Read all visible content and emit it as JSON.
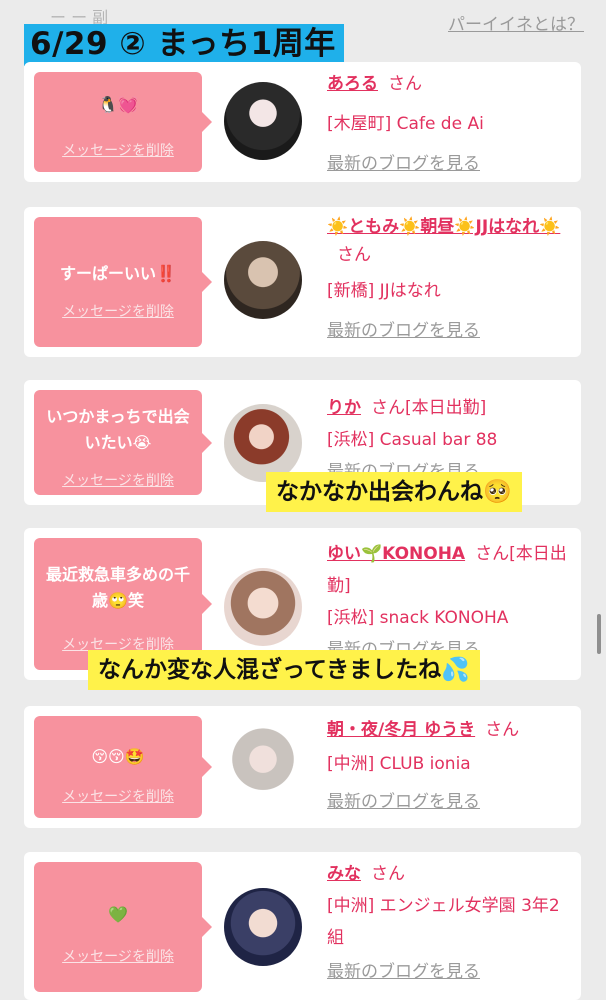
{
  "top": {
    "faded_text": "ー ー 副",
    "link": "パーイイネとは？",
    "banner": "6/29 ② まっち1周年"
  },
  "cards": [
    {
      "message": "🐧💓",
      "delete_label": "メッセージを削除",
      "name": "あろる",
      "san": "さん",
      "shop": "[木屋町] Cafe de Ai",
      "blog": "最新のブログを見る"
    },
    {
      "message": "すーぱーいい‼️",
      "delete_label": "メッセージを削除",
      "name": "☀️ともみ☀️朝昼☀️JJはなれ☀️",
      "san": "さん",
      "shop": "[新橋] JJはなれ",
      "blog": "最新のブログを見る"
    },
    {
      "message": "いつかまっちで出会いたい😭",
      "delete_label": "メッセージを削除",
      "name": "りか",
      "san": "さん",
      "note": "[本日出勤]",
      "shop": "[浜松] Casual bar 88",
      "blog": "最新のブログを見る"
    },
    {
      "message": "最近救急車多めの千歳🙄笑",
      "delete_label": "メッセージを削除",
      "name": "ゆい🌱KONOHA",
      "san": "さん",
      "note": "[本日出勤]",
      "shop": "[浜松] snack KONOHA",
      "blog": "最新のブログを見る"
    },
    {
      "message": "😚😚🤩",
      "delete_label": "メッセージを削除",
      "name": "朝・夜/冬月 ゆうき",
      "san": "さん",
      "shop": "[中洲] CLUB ionia",
      "blog": "最新のブログを見る"
    },
    {
      "message": "💚",
      "delete_label": "メッセージを削除",
      "name": "みな",
      "san": "さん",
      "shop": "[中洲] エンジェル女学園 3年2組",
      "blog": "最新のブログを見る"
    }
  ],
  "captions": {
    "first": "なかなか出会わんね🥺",
    "second": "なんか変な人混ざってきましたね💦"
  },
  "colors": {
    "banner_bg": "#1fb0ea",
    "caption_bg": "#fff24a",
    "bubble_bg": "#f7929e",
    "name_color": "#e2315f"
  }
}
